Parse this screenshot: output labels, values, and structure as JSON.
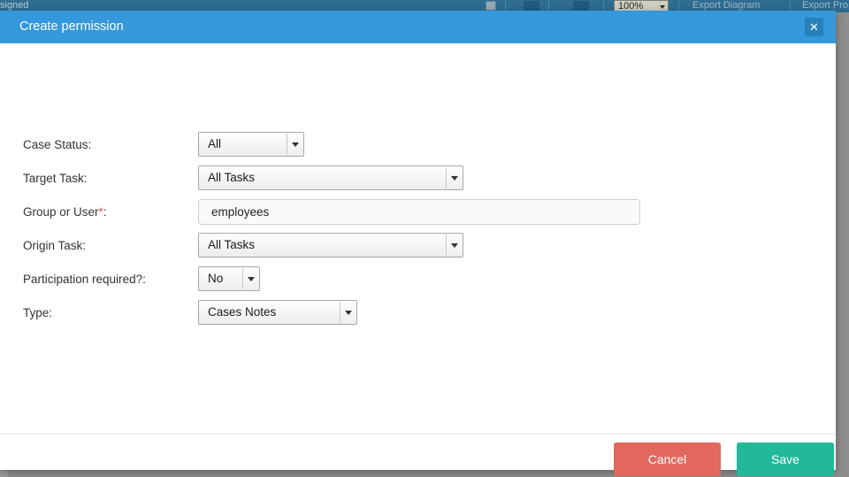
{
  "background_toolbar": {
    "left_text": "signed",
    "zoom_value": "100%",
    "export_diagram_label": "Export Diagram",
    "export_process_label": "Export Pro"
  },
  "modal": {
    "title": "Create permission",
    "close_icon": "close-icon",
    "form": {
      "fields": [
        {
          "label": "Case Status:",
          "required": false,
          "control": "select",
          "value": "All",
          "name": "case-status"
        },
        {
          "label": "Target Task:",
          "required": false,
          "control": "select",
          "value": "All Tasks",
          "name": "target-task"
        },
        {
          "label": "Group or User",
          "label_suffix": ":",
          "required": true,
          "required_mark": "*",
          "control": "text",
          "value": "employees",
          "placeholder": "",
          "name": "group-or-user"
        },
        {
          "label": "Origin Task:",
          "required": false,
          "control": "select",
          "value": "All Tasks",
          "name": "origin-task"
        },
        {
          "label": "Participation required?:",
          "required": false,
          "control": "select",
          "value": "No",
          "name": "participation-required"
        },
        {
          "label": "Type:",
          "required": false,
          "control": "select",
          "value": "Cases Notes",
          "name": "type"
        }
      ]
    },
    "footer": {
      "cancel_label": "Cancel",
      "save_label": "Save"
    }
  },
  "colors": {
    "header_blue": "#3498db",
    "close_blue": "#2980b9",
    "cancel_red": "#e2685e",
    "save_teal": "#22b99a",
    "required_red": "#d9534f",
    "backdrop_gray": "#8e8e8e",
    "toolbar_blue": "#2f6d91"
  }
}
